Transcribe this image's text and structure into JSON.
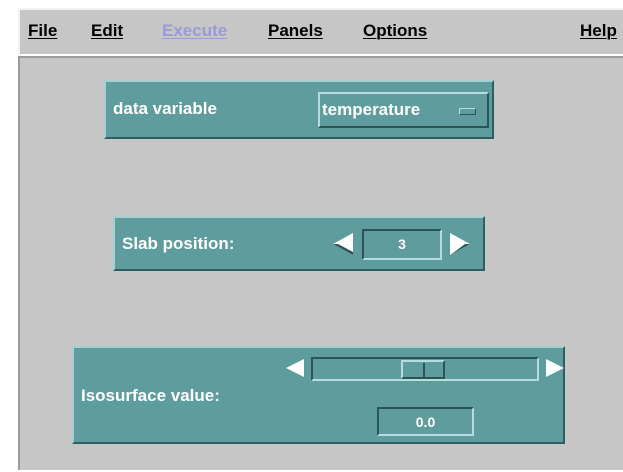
{
  "menu": {
    "file": "File",
    "edit": "Edit",
    "execute": "Execute",
    "panels": "Panels",
    "options": "Options",
    "help": "Help"
  },
  "data_variable": {
    "label": "data variable",
    "selected": "temperature"
  },
  "slab": {
    "label": "Slab position:",
    "value": "3"
  },
  "isosurface": {
    "label": "Isosurface value:",
    "value": "0.0",
    "slider_fraction": 0.49
  },
  "colors": {
    "panel": "#5f9c9e",
    "background": "#c6c6c6",
    "disabled_menu": "#9a9ad6"
  }
}
